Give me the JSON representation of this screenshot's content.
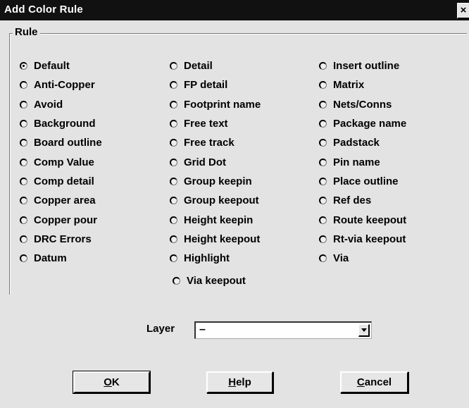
{
  "window": {
    "title": "Add Color Rule",
    "close_label": "×"
  },
  "rule_group": {
    "legend": "Rule",
    "columns": [
      [
        {
          "label": "Default",
          "checked": true
        },
        {
          "label": "Anti-Copper",
          "checked": false
        },
        {
          "label": "Avoid",
          "checked": false
        },
        {
          "label": "Background",
          "checked": false
        },
        {
          "label": "Board outline",
          "checked": false
        },
        {
          "label": "Comp Value",
          "checked": false
        },
        {
          "label": "Comp detail",
          "checked": false
        },
        {
          "label": "Copper area",
          "checked": false
        },
        {
          "label": "Copper pour",
          "checked": false
        },
        {
          "label": "DRC Errors",
          "checked": false
        },
        {
          "label": "Datum",
          "checked": false
        }
      ],
      [
        {
          "label": "Detail",
          "checked": false
        },
        {
          "label": "FP detail",
          "checked": false
        },
        {
          "label": "Footprint name",
          "checked": false
        },
        {
          "label": "Free text",
          "checked": false
        },
        {
          "label": "Free track",
          "checked": false
        },
        {
          "label": "Grid Dot",
          "checked": false
        },
        {
          "label": "Group keepin",
          "checked": false
        },
        {
          "label": "Group keepout",
          "checked": false
        },
        {
          "label": "Height keepin",
          "checked": false
        },
        {
          "label": "Height keepout",
          "checked": false
        },
        {
          "label": "Highlight",
          "checked": false
        }
      ],
      [
        {
          "label": "Insert outline",
          "checked": false
        },
        {
          "label": "Matrix",
          "checked": false
        },
        {
          "label": "Nets/Conns",
          "checked": false
        },
        {
          "label": "Package name",
          "checked": false
        },
        {
          "label": "Padstack",
          "checked": false
        },
        {
          "label": "Pin name",
          "checked": false
        },
        {
          "label": "Place outline",
          "checked": false
        },
        {
          "label": "Ref des",
          "checked": false
        },
        {
          "label": "Route keepout",
          "checked": false
        },
        {
          "label": "Rt-via keepout",
          "checked": false
        },
        {
          "label": "Via",
          "checked": false
        }
      ]
    ],
    "extra": {
      "label": "Via keepout",
      "checked": false
    }
  },
  "layer": {
    "label": "Layer",
    "value": "–"
  },
  "buttons": {
    "ok": {
      "mnemonic": "O",
      "rest": "K"
    },
    "help": {
      "mnemonic": "H",
      "rest": "elp"
    },
    "cancel": {
      "mnemonic": "C",
      "rest": "ancel"
    }
  }
}
